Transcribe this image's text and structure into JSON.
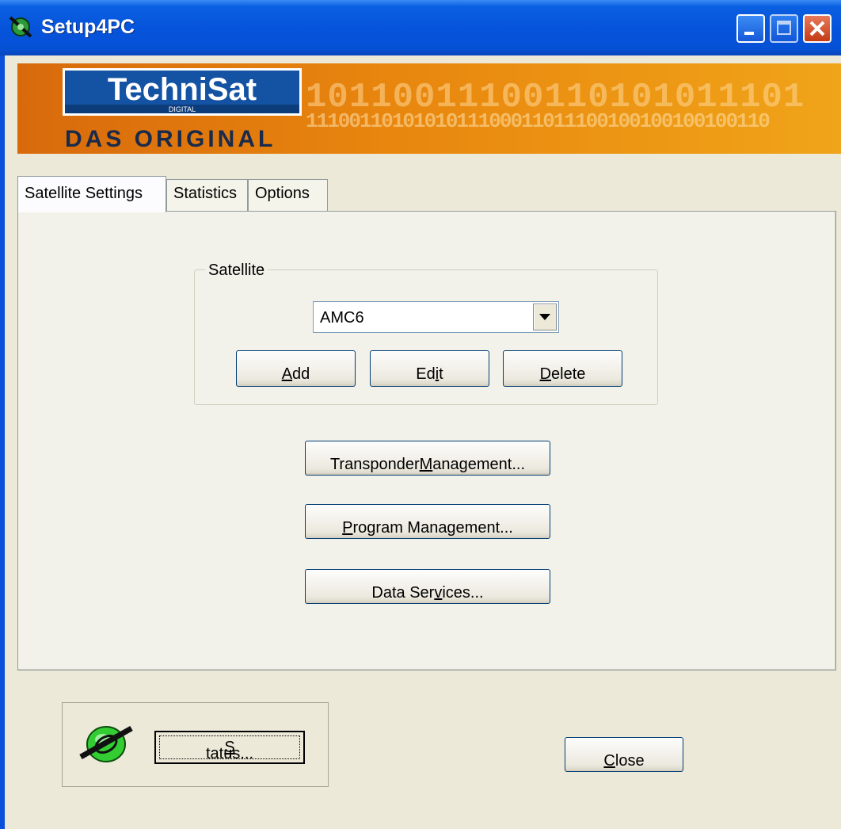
{
  "window": {
    "title": "Setup4PC"
  },
  "banner": {
    "logo_top": "TechniSat",
    "logo_sub": "DIGITAL",
    "logo_bottom": "DAS ORIGINAL",
    "binary_large": "10110011100110101011101",
    "binary_small": "1110011010101011100011011100100100100100110"
  },
  "tabs": [
    {
      "label": "Satellite Settings",
      "active": true
    },
    {
      "label": "Statistics",
      "active": false
    },
    {
      "label": "Options",
      "active": false
    }
  ],
  "satellite_group": {
    "legend": "Satellite",
    "selected": "AMC6",
    "buttons": {
      "add": {
        "pre": "",
        "u": "A",
        "post": "dd"
      },
      "edit": {
        "pre": "Ed",
        "u": "i",
        "post": "t"
      },
      "delete": {
        "pre": "",
        "u": "D",
        "post": "elete"
      }
    }
  },
  "actions": {
    "transponder": {
      "pre": "Transponder ",
      "u": "M",
      "post": "anagement..."
    },
    "program": {
      "pre": "",
      "u": "P",
      "post": "rogram Management..."
    },
    "data_services": {
      "pre": "Data Ser",
      "u": "v",
      "post": "ices..."
    }
  },
  "footer": {
    "status": {
      "pre": "",
      "u": "S",
      "post": "tatus..."
    },
    "close": {
      "pre": "",
      "u": "C",
      "post": "lose"
    }
  }
}
